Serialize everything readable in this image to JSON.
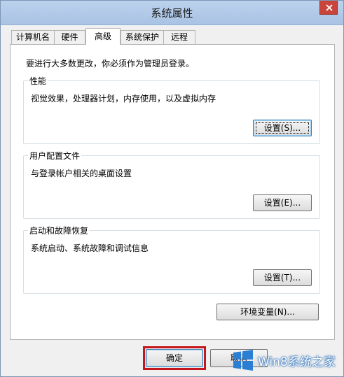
{
  "window": {
    "title": "系统属性"
  },
  "tabs": [
    {
      "label": "计算机名"
    },
    {
      "label": "硬件"
    },
    {
      "label": "高级",
      "active": true
    },
    {
      "label": "系统保护"
    },
    {
      "label": "远程"
    }
  ],
  "panel": {
    "admin_notice": "要进行大多数更改，你必须作为管理员登录。",
    "groups": [
      {
        "title": "性能",
        "description": "视觉效果，处理器计划，内存使用，以及虚拟内存",
        "button_label": "设置(S)..."
      },
      {
        "title": "用户配置文件",
        "description": "与登录帐户相关的桌面设置",
        "button_label": "设置(E)..."
      },
      {
        "title": "启动和故障恢复",
        "description": "系统启动、系统故障和调试信息",
        "button_label": "设置(T)..."
      }
    ],
    "env_button_label": "环境变量(N)..."
  },
  "footer": {
    "ok_label": "确定",
    "cancel_label": "取消"
  },
  "watermark": {
    "text": "Win8系统之家"
  },
  "colors": {
    "titlebar": "#bcd2ec",
    "highlight": "#c4161c",
    "close_button": "#c9453b"
  },
  "icons": {
    "close": "close-icon",
    "watermark_logo": "windows-logo-icon"
  }
}
